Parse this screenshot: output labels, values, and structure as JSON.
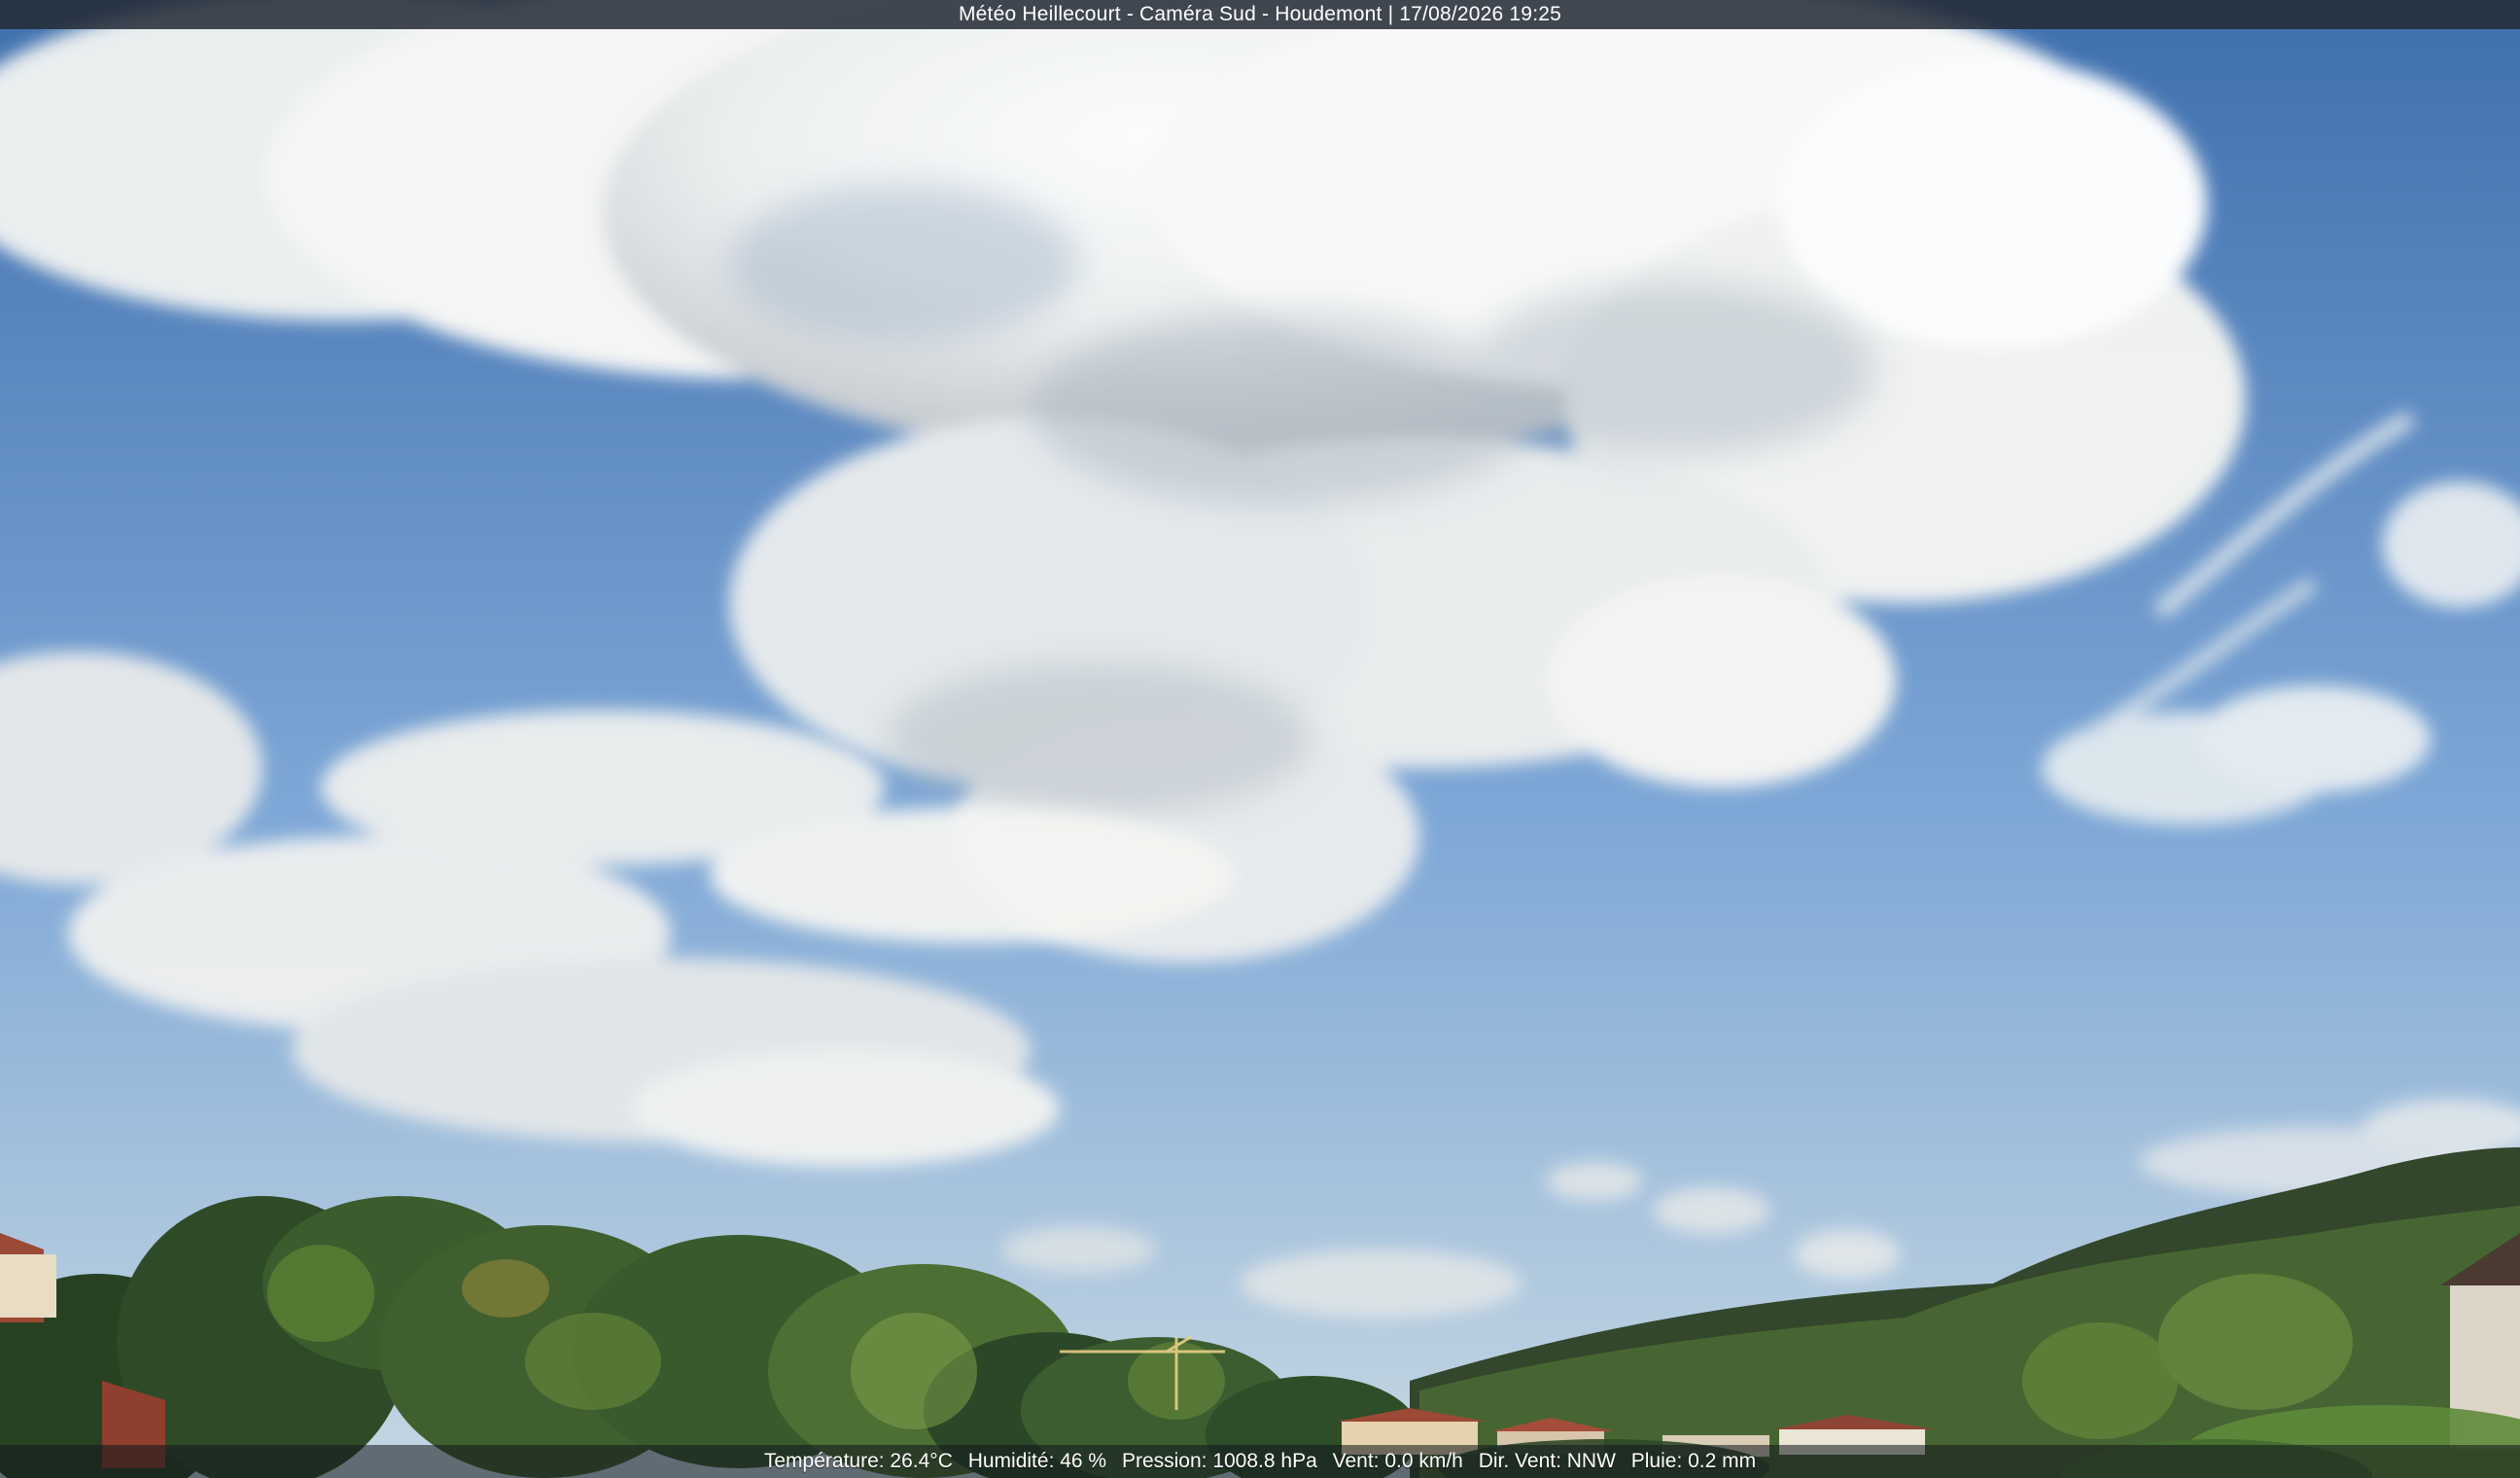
{
  "camera": {
    "title": "Météo Heillecourt - Caméra Sud - Houdemont | 17/08/2026 19:25"
  },
  "weather": {
    "temperature": "Température: 26.4°C",
    "humidity": "Humidité: 46 %",
    "pressure": "Pression: 1008.8 hPa",
    "wind_speed": "Vent: 0.0 km/h",
    "wind_direction": "Dir. Vent: NNW",
    "rain": "Pluie: 0.2 mm"
  },
  "colors": {
    "sky_top": "#3f6fae",
    "sky_mid": "#7da7d6",
    "sky_horizon": "#c6d7e2",
    "cloud_white": "#f7f8f8",
    "cloud_shadow": "#b9bec4",
    "trees_dark": "#263f24",
    "trees_light": "#6f8f3d",
    "roof_red": "#9b4a36"
  }
}
